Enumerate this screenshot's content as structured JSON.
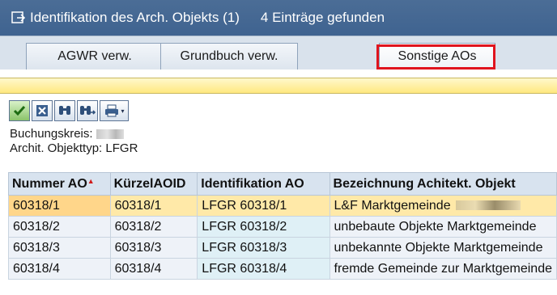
{
  "window": {
    "title": "Identifikation des Arch. Objekts (1)",
    "count_text": "4 Einträge gefunden",
    "title_icon": "window-icon"
  },
  "tabs": [
    {
      "label": "AGWR verw.",
      "active": false
    },
    {
      "label": "Grundbuch verw.",
      "active": false
    },
    {
      "label": "Sonstige AOs",
      "active": true
    }
  ],
  "toolbar": {
    "buttons": [
      {
        "name": "confirm-icon"
      },
      {
        "name": "cancel-icon"
      },
      {
        "name": "find-icon"
      },
      {
        "name": "find-next-icon"
      },
      {
        "name": "print-icon"
      }
    ]
  },
  "info": {
    "buchungskreis_label": "Buchungskreis:",
    "objekttyp_label": "Archit. Objekttyp:",
    "objekttyp_value": "LFGR"
  },
  "table": {
    "columns": [
      "Nummer AO",
      "KürzelAOID",
      "Identifikation AO",
      "Bezeichnung Achitekt. Objekt"
    ],
    "rows": [
      [
        "60318/1",
        "60318/1",
        "LFGR 60318/1",
        "L&F Marktgemeinde"
      ],
      [
        "60318/2",
        "60318/2",
        "LFGR 60318/2",
        "unbebaute Objekte Marktgemeinde"
      ],
      [
        "60318/3",
        "60318/3",
        "LFGR 60318/3",
        "unbekannte Objekte Marktgemeinde"
      ],
      [
        "60318/4",
        "60318/4",
        "LFGR 60318/4",
        "fremde Gemeinde zur Marktgemeinde"
      ]
    ]
  },
  "colors": {
    "titlebar": "#3f6390",
    "highlight": "#e0141e",
    "selected_row": "#ffe9a8"
  }
}
